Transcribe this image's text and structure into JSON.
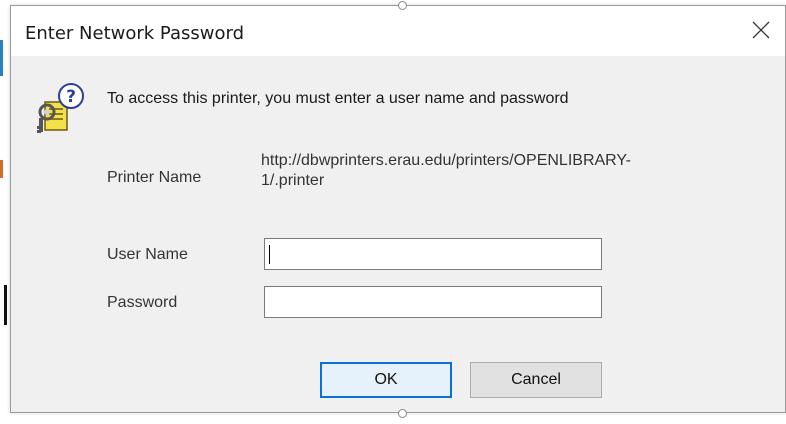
{
  "dialog": {
    "title": "Enter Network Password",
    "close_glyph": "✕",
    "message": "To access this printer, you must enter a user name and password",
    "icon": "key-question-icon"
  },
  "fields": {
    "printer_name_label": "Printer Name",
    "printer_name_value_line1": "http://dbwprinters.erau.edu/printers/OPENLIBRARY-",
    "printer_name_value_line2": "1/.printer",
    "user_name_label": "User Name",
    "user_name_value": "",
    "password_label": "Password",
    "password_value": ""
  },
  "buttons": {
    "ok_label": "OK",
    "cancel_label": "Cancel"
  },
  "colors": {
    "dialog_bg": "#f0f0f0",
    "accent": "#0a6fd6"
  }
}
